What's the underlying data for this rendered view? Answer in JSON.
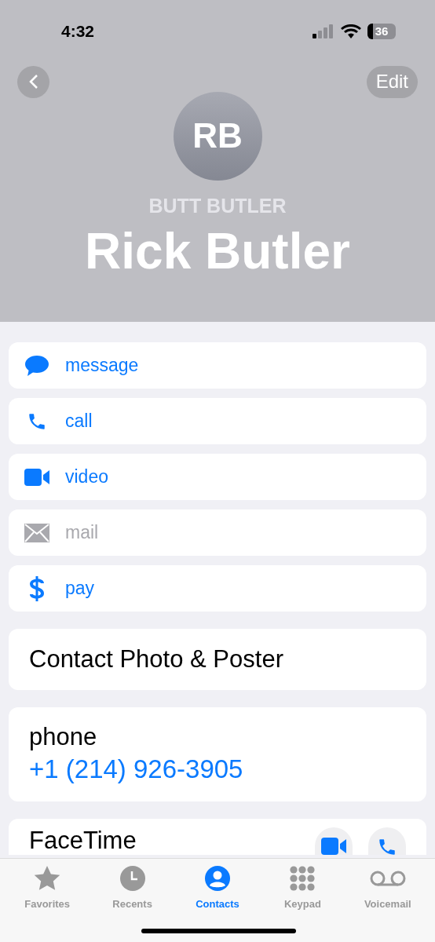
{
  "status_bar": {
    "time": "4:32",
    "battery": "36"
  },
  "nav": {
    "edit": "Edit"
  },
  "contact": {
    "initials": "RB",
    "nickname": "BUTT BUTLER",
    "name": "Rick Butler"
  },
  "actions": [
    {
      "kind": "message",
      "label": "message",
      "disabled": false
    },
    {
      "kind": "call",
      "label": "call",
      "disabled": false
    },
    {
      "kind": "video",
      "label": "video",
      "disabled": false
    },
    {
      "kind": "mail",
      "label": "mail",
      "disabled": true
    },
    {
      "kind": "pay",
      "label": "pay",
      "disabled": false
    }
  ],
  "contact_photo": "Contact Photo & Poster",
  "phone": {
    "label": "phone",
    "number": "+1 (214) 926-3905"
  },
  "facetime": {
    "label": "FaceTime"
  },
  "tab_bar": [
    {
      "kind": "favorites",
      "label": "Favorites",
      "selected": false
    },
    {
      "kind": "recents",
      "label": "Recents",
      "selected": false
    },
    {
      "kind": "contacts",
      "label": "Contacts",
      "selected": true
    },
    {
      "kind": "keypad",
      "label": "Keypad",
      "selected": false
    },
    {
      "kind": "voicemail",
      "label": "Voicemail",
      "selected": false
    }
  ]
}
